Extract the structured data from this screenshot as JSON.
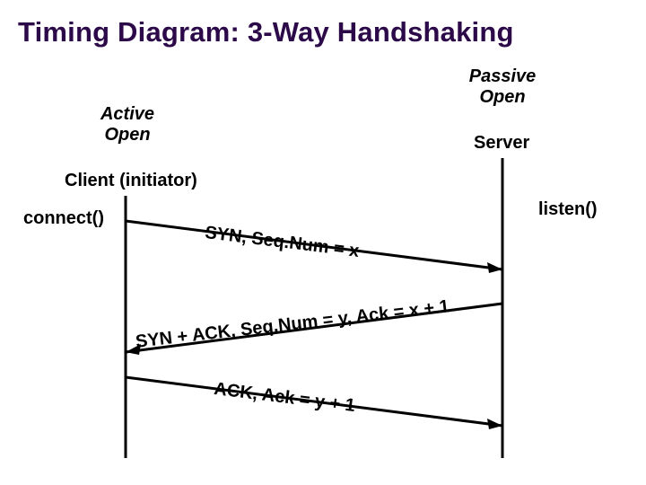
{
  "title": "Timing Diagram: 3-Way Handshaking",
  "labels": {
    "activeOpen": "Active\nOpen",
    "passiveOpen": "Passive\nOpen",
    "client": "Client (initiator)",
    "server": "Server",
    "connect": "connect()",
    "listen": "listen()"
  },
  "messages": {
    "syn": "SYN, Seq.Num = x",
    "synack": "SYN + ACK, Seq.Num = y, Ack = x + 1",
    "ack": "ACK, Ack = y + 1"
  },
  "chart_data": {
    "type": "sequence-diagram",
    "title": "Timing Diagram: 3-Way Handshaking",
    "participants": [
      {
        "name": "Client (initiator)",
        "role": "Active Open",
        "action": "connect()"
      },
      {
        "name": "Server",
        "role": "Passive Open",
        "action": "listen()"
      }
    ],
    "messages": [
      {
        "from": "Client",
        "to": "Server",
        "label": "SYN, Seq.Num = x"
      },
      {
        "from": "Server",
        "to": "Client",
        "label": "SYN + ACK, Seq.Num = y, Ack = x + 1"
      },
      {
        "from": "Client",
        "to": "Server",
        "label": "ACK, Ack = y + 1"
      }
    ]
  }
}
